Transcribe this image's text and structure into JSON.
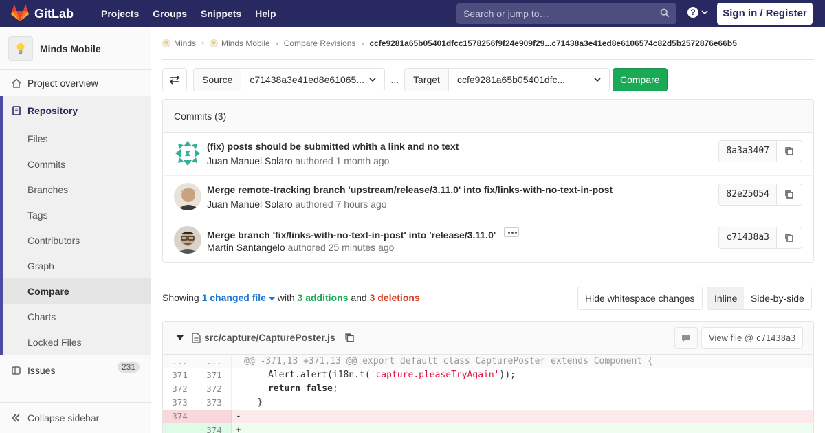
{
  "topbar": {
    "brand": "GitLab",
    "nav": [
      "Projects",
      "Groups",
      "Snippets",
      "Help"
    ],
    "search_placeholder": "Search or jump to…",
    "help_glyph": "?",
    "signin": "Sign in / Register",
    "brand_color": "#292961"
  },
  "sidebar": {
    "project_name": "Minds Mobile",
    "overview": "Project overview",
    "repository": "Repository",
    "repo_items": [
      "Files",
      "Commits",
      "Branches",
      "Tags",
      "Contributors",
      "Graph",
      "Compare",
      "Charts",
      "Locked Files"
    ],
    "active_item": "Compare",
    "issues": "Issues",
    "issues_count": "231",
    "collapse": "Collapse sidebar"
  },
  "breadcrumb": {
    "items": [
      "Minds",
      "Minds Mobile",
      "Compare Revisions"
    ],
    "current": "ccfe9281a65b05401dfcc1578256f9f24e909f29...c71438a3e41ed8e6106574c82d5b2572876e66b5"
  },
  "compare": {
    "source_label": "Source",
    "source_value": "c71438a3e41ed8e61065...",
    "separator": "...",
    "target_label": "Target",
    "target_value": "ccfe9281a65b05401dfc...",
    "button": "Compare"
  },
  "commits": {
    "header": "Commits (3)",
    "rows": [
      {
        "title": "(fix) posts should be submitted whith a link and no text",
        "author": "Juan Manuel Solaro",
        "verb": "authored",
        "time": "1 month ago",
        "sha": "8a3a3407"
      },
      {
        "title": "Merge remote-tracking branch 'upstream/release/3.11.0' into fix/links-with-no-text-in-post",
        "author": "Juan Manuel Solaro",
        "verb": "authored",
        "time": "7 hours ago",
        "sha": "82e25054"
      },
      {
        "title": "Merge branch 'fix/links-with-no-text-in-post' into 'release/3.11.0'",
        "author": "Martin Santangelo",
        "verb": "authored",
        "time": "25 minutes ago",
        "sha": "c71438a3"
      }
    ]
  },
  "stats": {
    "showing": "Showing",
    "changed": "1 changed file",
    "with": "with",
    "additions": "3 additions",
    "and": "and",
    "deletions": "3 deletions",
    "hide_ws": "Hide whitespace changes",
    "inline": "Inline",
    "side_by_side": "Side-by-side"
  },
  "file": {
    "path": "src/capture/CapturePoster.js",
    "view_file": "View file @",
    "view_sha": "c71438a3",
    "lines": [
      {
        "type": "match",
        "old": "...",
        "new": "...",
        "code": "@@ -371,13 +371,13 @@ export default class CapturePoster extends Component {"
      },
      {
        "type": "ctx",
        "old": "371",
        "new": "371",
        "pre": "      Alert.alert(i18n.t(",
        "str": "'capture.pleaseTryAgain'",
        "post": "));"
      },
      {
        "type": "ctx",
        "old": "372",
        "new": "372",
        "pre": "      ",
        "kw": "return false",
        "post": ";"
      },
      {
        "type": "ctx",
        "old": "373",
        "new": "373",
        "code": "    }"
      },
      {
        "type": "old",
        "old": "374",
        "new": "",
        "code": "-"
      },
      {
        "type": "new",
        "old": "",
        "new": "374",
        "code": "+"
      }
    ]
  }
}
